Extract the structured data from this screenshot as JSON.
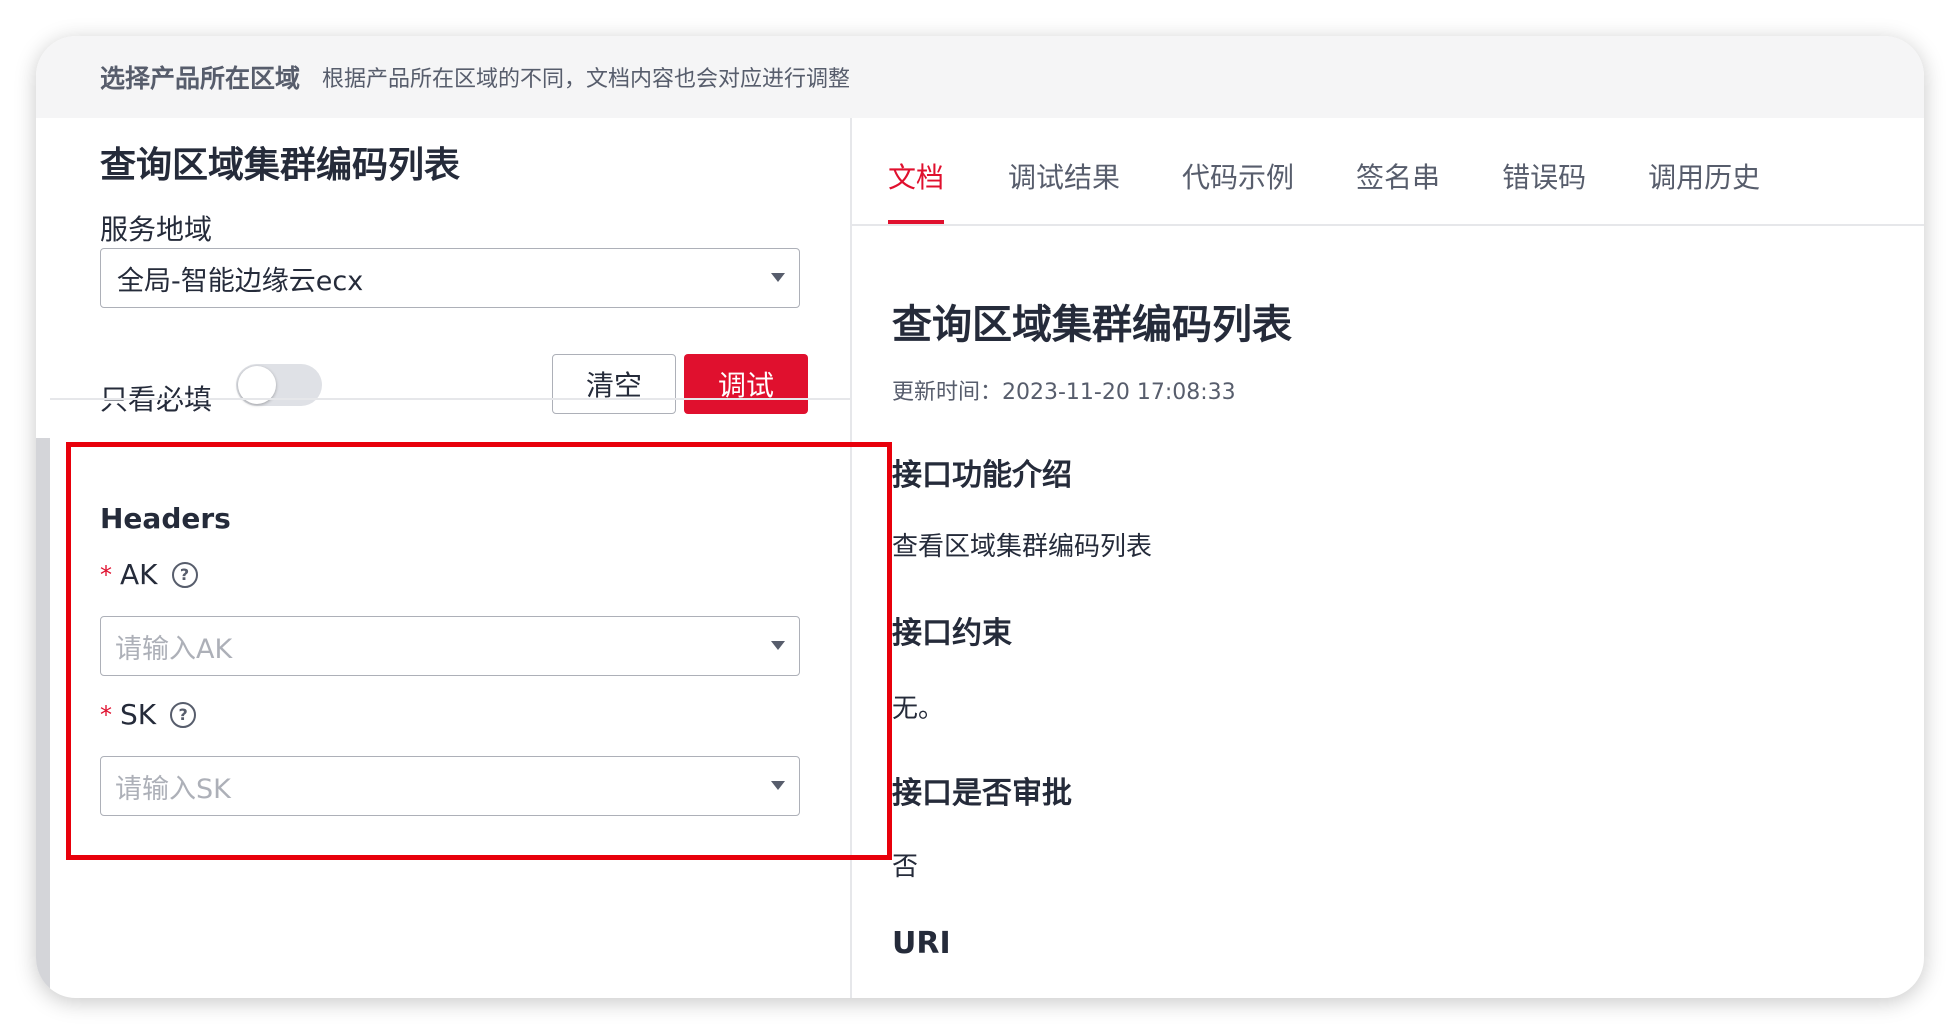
{
  "region_bar": {
    "title": "选择产品所在区域",
    "description": "根据产品所在区域的不同，文档内容也会对应进行调整"
  },
  "left": {
    "api_title": "查询区域集群编码列表",
    "service_region_label": "服务地域",
    "service_region_value": "全局-智能边缘云ecx",
    "required_only_label": "只看必填",
    "required_only_on": false,
    "clear_button": "清空",
    "debug_button": "调试",
    "headers_title": "Headers",
    "ak": {
      "required_mark": "*",
      "label": "AK",
      "placeholder": "请输入AK"
    },
    "sk": {
      "required_mark": "*",
      "label": "SK",
      "placeholder": "请输入SK"
    },
    "accent_color": "#e0102e",
    "highlight_color": "#e8000b"
  },
  "tabs": [
    {
      "label": "文档",
      "active": true
    },
    {
      "label": "调试结果",
      "active": false
    },
    {
      "label": "代码示例",
      "active": false
    },
    {
      "label": "签名串",
      "active": false
    },
    {
      "label": "错误码",
      "active": false
    },
    {
      "label": "调用历史",
      "active": false
    }
  ],
  "doc": {
    "title": "查询区域集群编码列表",
    "updated": "更新时间：2023-11-20 17:08:33",
    "sections": [
      {
        "heading": "接口功能介绍",
        "body": "查看区域集群编码列表"
      },
      {
        "heading": "接口约束",
        "body": "无。"
      },
      {
        "heading": "接口是否审批",
        "body": "否"
      },
      {
        "heading": "URI",
        "body": ""
      }
    ]
  }
}
